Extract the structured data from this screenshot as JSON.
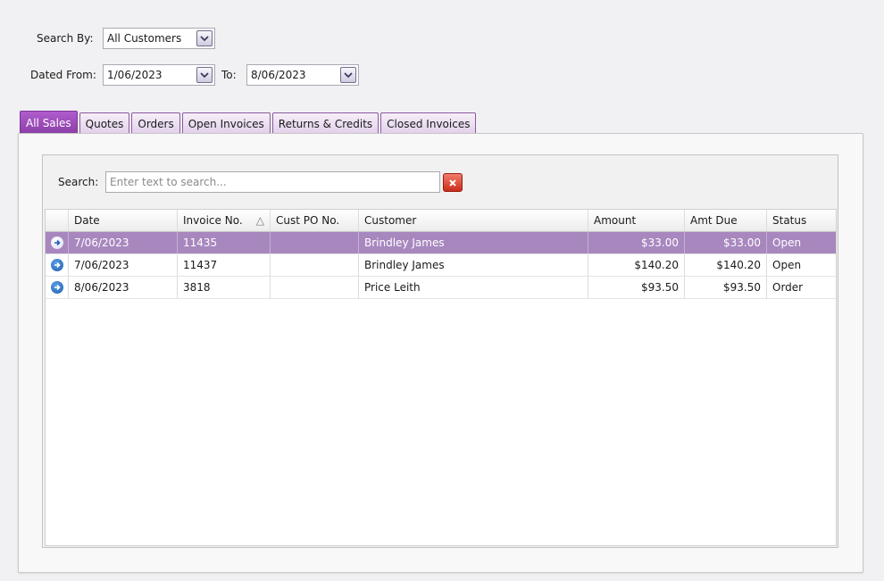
{
  "filters": {
    "search_by_label": "Search By:",
    "search_by_value": "All Customers",
    "dated_from_label": "Dated From:",
    "dated_from_value": "1/06/2023",
    "to_label": "To:",
    "to_value": "8/06/2023"
  },
  "tabs": [
    {
      "label": "All Sales",
      "active": true
    },
    {
      "label": "Quotes",
      "active": false
    },
    {
      "label": "Orders",
      "active": false
    },
    {
      "label": "Open Invoices",
      "active": false
    },
    {
      "label": "Returns & Credits",
      "active": false
    },
    {
      "label": "Closed Invoices",
      "active": false
    }
  ],
  "search": {
    "label": "Search:",
    "placeholder": "Enter text to search..."
  },
  "table": {
    "columns": [
      "Date",
      "Invoice No.",
      "Cust PO No.",
      "Customer",
      "Amount",
      "Amt Due",
      "Status"
    ],
    "sort_indicator": "△",
    "rows": [
      {
        "date": "7/06/2023",
        "invoice": "11435",
        "cust_po": "",
        "customer": "Brindley James",
        "amount": "$33.00",
        "amt_due": "$33.00",
        "status": "Open"
      },
      {
        "date": "7/06/2023",
        "invoice": "11437",
        "cust_po": "",
        "customer": "Brindley James",
        "amount": "$140.20",
        "amt_due": "$140.20",
        "status": "Open"
      },
      {
        "date": "8/06/2023",
        "invoice": "3818",
        "cust_po": "",
        "customer": "Price Leith",
        "amount": "$93.50",
        "amt_due": "$93.50",
        "status": "Order"
      }
    ]
  },
  "colors": {
    "accent": "#8b3fa7",
    "selected_row": "#a887bf"
  }
}
